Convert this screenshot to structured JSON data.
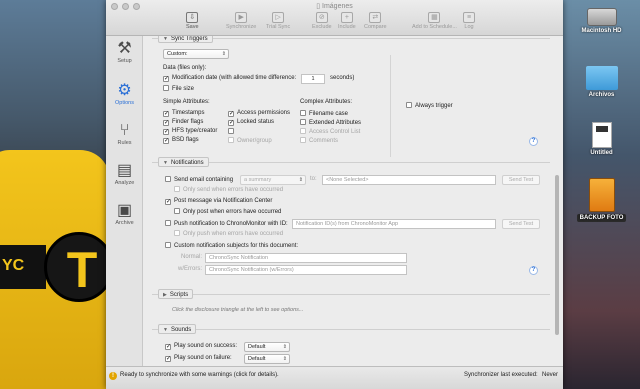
{
  "window": {
    "title": "Imágenes"
  },
  "toolbar": {
    "save": "Save",
    "synchronize": "Synchronize",
    "trial_sync": "Trial Sync",
    "exclude": "Exclude",
    "include": "Include",
    "compare": "Compare",
    "add_to_schedule": "Add to Schedule...",
    "log": "Log"
  },
  "sidebar": {
    "items": [
      {
        "label": "Setup",
        "icon": "wrench-icon"
      },
      {
        "label": "Options",
        "icon": "gear-icon"
      },
      {
        "label": "Rules",
        "icon": "branch-icon"
      },
      {
        "label": "Analyze",
        "icon": "document-chart-icon"
      },
      {
        "label": "Archive",
        "icon": "archive-box-icon"
      }
    ],
    "active": "Options"
  },
  "sync_triggers": {
    "heading": "Sync Triggers",
    "mode": "Custom:",
    "data_label": "Data (files only):",
    "modification_date": "Modification date (with allowed time difference:",
    "time_difference": "1",
    "seconds": "seconds)",
    "file_size": "File size",
    "simple_heading": "Simple Attributes:",
    "simple": [
      {
        "label": "Timestamps",
        "checked": true,
        "enabled": true
      },
      {
        "label": "Finder flags",
        "checked": true,
        "enabled": true
      },
      {
        "label": "HFS type/creator",
        "checked": true,
        "enabled": true
      },
      {
        "label": "BSD flags",
        "checked": true,
        "enabled": true
      }
    ],
    "simple2": [
      {
        "label": "Access permissions",
        "checked": true,
        "enabled": true
      },
      {
        "label": "Locked status",
        "checked": true,
        "enabled": true
      },
      {
        "label": "",
        "checked": false,
        "enabled": true
      },
      {
        "label": "Owner/group",
        "checked": false,
        "enabled": false
      }
    ],
    "complex_heading": "Complex Attributes:",
    "complex": [
      {
        "label": "Filename case",
        "checked": false,
        "enabled": true
      },
      {
        "label": "Extended Attributes",
        "checked": false,
        "enabled": true
      },
      {
        "label": "Access Control List",
        "checked": false,
        "enabled": false
      },
      {
        "label": "Comments",
        "checked": false,
        "enabled": false
      }
    ],
    "always_trigger": "Always trigger"
  },
  "notifications": {
    "heading": "Notifications",
    "send_email": "Send email containing",
    "summary": "a summary",
    "to": "to:",
    "none_selected": "<None Selected>",
    "send_test": "Send Test",
    "only_send_errors": "Only send when errors have occurred",
    "post_message": "Post message via Notification Center",
    "only_post_errors": "Only post when errors have occurred",
    "push_notification": "Push notification to ChronoMonitor with ID:",
    "push_placeholder": "Notification ID(s) from ChronoMonitor App",
    "only_push_errors": "Only push when errors have occurred",
    "custom_subjects": "Custom notification subjects for this document:",
    "normal_label": "Normal:",
    "normal_value": "ChronoSync Notification",
    "errors_label": "w/Errors:",
    "errors_value": "ChronoSync Notification (w/Errors)"
  },
  "scripts": {
    "heading": "Scripts",
    "hint": "Click the disclosure triangle at the left to see options..."
  },
  "sounds": {
    "heading": "Sounds",
    "success": "Play sound on success:",
    "failure": "Play sound on failure:",
    "success_value": "Default",
    "failure_value": "Default"
  },
  "status": {
    "message": "Ready to synchronize with some warnings (click for details).",
    "last_executed_label": "Synchronizer last executed:",
    "last_executed_value": "Never"
  },
  "desktop": {
    "icons": [
      "Macintosh HD",
      "Archivos",
      "Untitled",
      "BACKUP FOTO"
    ],
    "taxi_sign": "YC",
    "taxi_letter": "T"
  }
}
